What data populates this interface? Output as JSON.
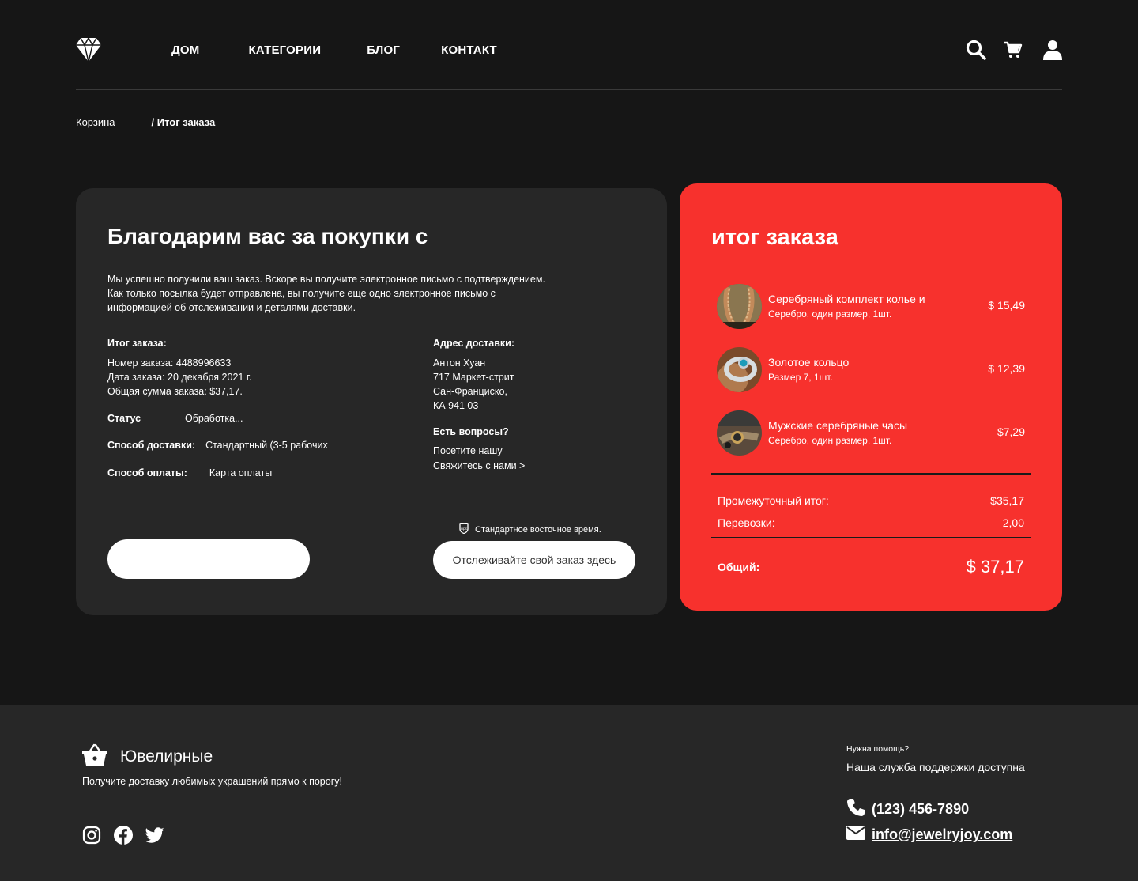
{
  "nav": {
    "items": [
      "ДОМ",
      "КАТЕГОРИИ",
      "БЛОГ",
      "КОНТАКТ"
    ]
  },
  "header_icons": [
    "search-icon",
    "cart-icon",
    "user-icon"
  ],
  "breadcrumb": {
    "link": "Корзина",
    "current": "/ Итог заказа"
  },
  "thanks": {
    "title": "Благодарим вас за покупки с",
    "message": [
      "Мы успешно получили ваш заказ. Вскоре вы получите электронное письмо с подтверждением.",
      "Как только посылка будет отправлена, вы получите еще одно электронное письмо с",
      "информацией об отслеживании и деталями доставки."
    ],
    "summary_label": "Итог заказа:",
    "order_number": "Номер заказа: 4488996633",
    "order_date": "Дата заказа: 20 декабря 2021 г.",
    "order_total": "Общая сумма заказа: $37,17.",
    "status_label": "Статус",
    "status_value": "Обработка...",
    "shipping_label": "Способ доставки:",
    "shipping_value": "Стандартный (3-5 рабочих",
    "payment_label": "Способ оплаты:",
    "payment_value": "Карта оплаты",
    "address_label": "Адрес доставки:",
    "address_lines": [
      "Антон Хуан",
      "717 Маркет-стрит",
      "Сан-Франциско,",
      "КА 941 03"
    ],
    "questions_label": "Есть вопросы?",
    "questions_line1": "Посетите нашу",
    "questions_link": "Свяжитесь с нами >",
    "timezone_note": "Стандартное восточное время.",
    "track_button": "Отслеживайте свой заказ здесь",
    "left_button": ""
  },
  "summary": {
    "title": "итог заказа",
    "items": [
      {
        "name": "Серебряный комплект колье и",
        "desc": "Серебро, один размер, 1шт.",
        "price": "$ 15,49"
      },
      {
        "name": "Золотое кольцо",
        "desc": "Размер 7, 1шт.",
        "price": "$ 12,39"
      },
      {
        "name": "Мужские серебряные часы",
        "desc": "Серебро, один размер, 1шт.",
        "price": "$7,29"
      }
    ],
    "subtotal_label": "Промежуточный итог:",
    "subtotal_value": "$35,17",
    "shipping_label": "Перевозки:",
    "shipping_value": "2,00",
    "total_label": "Общий:",
    "total_value": "$ 37,17"
  },
  "footer": {
    "brand": "Ювелирные",
    "tagline": "Получите доставку любимых украшений прямо к порогу!",
    "social": [
      "instagram-icon",
      "facebook-icon",
      "twitter-icon"
    ],
    "help_title": "Нужна помощь?",
    "help_text": "Наша служба поддержки доступна",
    "phone": "(123) 456-7890",
    "email": "info@jewelryjoy.com"
  },
  "colors": {
    "background": "#161616",
    "card": "#272727",
    "accent": "#f7312d"
  }
}
